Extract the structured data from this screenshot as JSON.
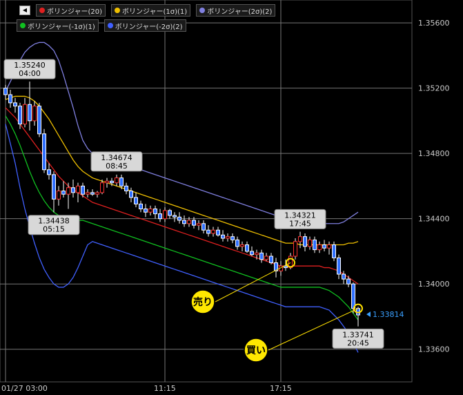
{
  "legend": [
    {
      "label": "ボリンジャー(20)",
      "color": "#e02020"
    },
    {
      "label": "ボリンジャー(1σ)(1)",
      "color": "#f0c000"
    },
    {
      "label": "ボリンジャー(2σ)(2)",
      "color": "#8080e0"
    },
    {
      "label": "ボリンジャー(-1σ)(1)",
      "color": "#10c020"
    },
    {
      "label": "ボリンジャー(-2σ)(2)",
      "color": "#4060ff"
    }
  ],
  "nav": {
    "back_icon": "◀"
  },
  "chart_data": {
    "type": "candlestick",
    "y_ticks": [
      "1.35600",
      "1.35200",
      "1.34800",
      "1.34400",
      "1.34000",
      "1.33600"
    ],
    "ylim": [
      1.334,
      1.3574
    ],
    "x_ticks": [
      {
        "label": "01/27 03:00",
        "i": 0
      },
      {
        "label": "11:15",
        "i": 33
      },
      {
        "label": "17:15",
        "i": 57
      }
    ],
    "price_marker": {
      "value": 1.33814,
      "label": "1.33814"
    },
    "callouts": [
      {
        "price": "1.35240",
        "time": "04:00",
        "i": 5,
        "value": 1.3524
      },
      {
        "price": "1.34438",
        "time": "05:15",
        "i": 10,
        "value": 1.34438
      },
      {
        "price": "1.34674",
        "time": "08:45",
        "i": 23,
        "value": 1.34674
      },
      {
        "price": "1.34321",
        "time": "17:45",
        "i": 61,
        "value": 1.34321
      },
      {
        "price": "1.33741",
        "time": "20:45",
        "i": 73,
        "value": 1.33741
      }
    ],
    "annotations": [
      {
        "label": "売り",
        "i": 59,
        "value": 1.3413
      },
      {
        "label": "買い",
        "i": 73,
        "value": 1.3385
      }
    ],
    "candles": [
      [
        1.352,
        1.3522,
        1.3513,
        1.3516
      ],
      [
        1.3516,
        1.3519,
        1.3508,
        1.3511
      ],
      [
        1.3511,
        1.3514,
        1.3505,
        1.3509
      ],
      [
        1.3509,
        1.3511,
        1.3495,
        1.3498
      ],
      [
        1.3498,
        1.3514,
        1.3496,
        1.351
      ],
      [
        1.351,
        1.3524,
        1.3494,
        1.35
      ],
      [
        1.35,
        1.3512,
        1.3497,
        1.3509
      ],
      [
        1.3509,
        1.3511,
        1.349,
        1.3492
      ],
      [
        1.3492,
        1.3495,
        1.3468,
        1.347
      ],
      [
        1.347,
        1.3474,
        1.3464,
        1.3467
      ],
      [
        1.3467,
        1.3469,
        1.3444,
        1.3452
      ],
      [
        1.3452,
        1.346,
        1.3448,
        1.3457
      ],
      [
        1.3457,
        1.3463,
        1.3453,
        1.3455
      ],
      [
        1.3455,
        1.3462,
        1.3446,
        1.3459
      ],
      [
        1.3459,
        1.3464,
        1.3453,
        1.3456
      ],
      [
        1.3456,
        1.3462,
        1.345,
        1.346
      ],
      [
        1.346,
        1.3462,
        1.3453,
        1.3455
      ],
      [
        1.3455,
        1.3458,
        1.3453,
        1.3456
      ],
      [
        1.3456,
        1.3458,
        1.3454,
        1.3455
      ],
      [
        1.3455,
        1.3457,
        1.3453,
        1.3456
      ],
      [
        1.3456,
        1.3464,
        1.3455,
        1.3462
      ],
      [
        1.3462,
        1.3465,
        1.3459,
        1.3463
      ],
      [
        1.3463,
        1.3465,
        1.346,
        1.3462
      ],
      [
        1.3462,
        1.3467,
        1.346,
        1.3465
      ],
      [
        1.3465,
        1.3467,
        1.3458,
        1.346
      ],
      [
        1.346,
        1.3462,
        1.3455,
        1.3457
      ],
      [
        1.3457,
        1.3459,
        1.345,
        1.3453
      ],
      [
        1.3453,
        1.3456,
        1.3447,
        1.3449
      ],
      [
        1.3449,
        1.3451,
        1.3444,
        1.3446
      ],
      [
        1.3446,
        1.3449,
        1.3441,
        1.3444
      ],
      [
        1.3444,
        1.3448,
        1.3442,
        1.3446
      ],
      [
        1.3446,
        1.3448,
        1.344,
        1.3443
      ],
      [
        1.3443,
        1.3446,
        1.3438,
        1.344
      ],
      [
        1.344,
        1.3447,
        1.3438,
        1.3445
      ],
      [
        1.3445,
        1.3446,
        1.344,
        1.3442
      ],
      [
        1.3442,
        1.3444,
        1.3438,
        1.3441
      ],
      [
        1.3441,
        1.3444,
        1.3437,
        1.3439
      ],
      [
        1.3439,
        1.3442,
        1.3435,
        1.3437
      ],
      [
        1.3437,
        1.3441,
        1.3435,
        1.3439
      ],
      [
        1.3439,
        1.3441,
        1.3434,
        1.3436
      ],
      [
        1.3436,
        1.3439,
        1.3433,
        1.3437
      ],
      [
        1.3437,
        1.3439,
        1.3431,
        1.3433
      ],
      [
        1.3433,
        1.3436,
        1.3429,
        1.3431
      ],
      [
        1.3431,
        1.3435,
        1.3429,
        1.3433
      ],
      [
        1.3433,
        1.3435,
        1.3429,
        1.343
      ],
      [
        1.343,
        1.3433,
        1.3426,
        1.3428
      ],
      [
        1.3428,
        1.3431,
        1.3426,
        1.3429
      ],
      [
        1.3429,
        1.3431,
        1.3425,
        1.3427
      ],
      [
        1.3427,
        1.3429,
        1.3421,
        1.3423
      ],
      [
        1.3423,
        1.3426,
        1.342,
        1.3424
      ],
      [
        1.3424,
        1.3426,
        1.3419,
        1.342
      ],
      [
        1.342,
        1.3423,
        1.3417,
        1.3418
      ],
      [
        1.3418,
        1.3421,
        1.3415,
        1.3419
      ],
      [
        1.3419,
        1.3421,
        1.3413,
        1.3415
      ],
      [
        1.3415,
        1.3419,
        1.3414,
        1.3417
      ],
      [
        1.3417,
        1.3419,
        1.3412,
        1.3413
      ],
      [
        1.3413,
        1.3416,
        1.3404,
        1.3408
      ],
      [
        1.3408,
        1.3414,
        1.3405,
        1.3411
      ],
      [
        1.3411,
        1.3415,
        1.3408,
        1.341
      ],
      [
        1.341,
        1.3419,
        1.3409,
        1.3417
      ],
      [
        1.3417,
        1.3428,
        1.3415,
        1.3426
      ],
      [
        1.3426,
        1.3432,
        1.3422,
        1.3429
      ],
      [
        1.3429,
        1.3431,
        1.342,
        1.3423
      ],
      [
        1.3423,
        1.3429,
        1.3421,
        1.3427
      ],
      [
        1.3427,
        1.3429,
        1.3419,
        1.3421
      ],
      [
        1.3421,
        1.3426,
        1.3419,
        1.3424
      ],
      [
        1.3424,
        1.3427,
        1.342,
        1.3422
      ],
      [
        1.3422,
        1.3426,
        1.3418,
        1.3424
      ],
      [
        1.3424,
        1.3426,
        1.3414,
        1.3416
      ],
      [
        1.3416,
        1.3418,
        1.3403,
        1.3406
      ],
      [
        1.3406,
        1.3408,
        1.34,
        1.3403
      ],
      [
        1.3403,
        1.3405,
        1.3398,
        1.34
      ],
      [
        1.34,
        1.3401,
        1.3382,
        1.3385
      ],
      [
        1.3385,
        1.3386,
        1.3374,
        1.3381
      ]
    ],
    "bands": {
      "mid": [
        1.3508,
        1.3505,
        1.3502,
        1.3498,
        1.3494,
        1.349,
        1.3486,
        1.3482,
        1.3478,
        1.3474,
        1.347,
        1.3466,
        1.3463,
        1.346,
        1.3458,
        1.3456,
        1.3454,
        1.3452,
        1.345,
        1.3449,
        1.3448,
        1.3447,
        1.3446,
        1.3445,
        1.3444,
        1.3443,
        1.3442,
        1.3441,
        1.344,
        1.3439,
        1.3438,
        1.3437,
        1.3436,
        1.3435,
        1.3434,
        1.3433,
        1.3432,
        1.3431,
        1.343,
        1.3429,
        1.3428,
        1.3427,
        1.3426,
        1.3425,
        1.3424,
        1.3423,
        1.3422,
        1.3421,
        1.342,
        1.3419,
        1.3418,
        1.3417,
        1.3416,
        1.3415,
        1.3414,
        1.3413,
        1.3412,
        1.3411,
        1.3411,
        1.3411,
        1.3411,
        1.3411,
        1.3411,
        1.3411,
        1.3411,
        1.3411,
        1.341,
        1.341,
        1.3409,
        1.3408,
        1.3406,
        1.3404,
        1.3402,
        1.34
      ],
      "up1": [
        1.3513,
        1.3514,
        1.3515,
        1.3515,
        1.3515,
        1.3514,
        1.3512,
        1.3509,
        1.3505,
        1.3501,
        1.3496,
        1.3491,
        1.3486,
        1.3481,
        1.3476,
        1.3472,
        1.3469,
        1.3467,
        1.3465,
        1.3464,
        1.3463,
        1.3462,
        1.3461,
        1.346,
        1.3459,
        1.3458,
        1.3457,
        1.3456,
        1.3455,
        1.3454,
        1.3453,
        1.3452,
        1.3451,
        1.345,
        1.3449,
        1.3448,
        1.3447,
        1.3446,
        1.3445,
        1.3444,
        1.3443,
        1.3442,
        1.3441,
        1.344,
        1.3439,
        1.3438,
        1.3437,
        1.3436,
        1.3435,
        1.3434,
        1.3433,
        1.3432,
        1.3431,
        1.343,
        1.3429,
        1.3428,
        1.3427,
        1.3426,
        1.3425,
        1.3425,
        1.3425,
        1.3424,
        1.3424,
        1.3424,
        1.3424,
        1.3424,
        1.3424,
        1.3424,
        1.3424,
        1.3424,
        1.3424,
        1.3425,
        1.3425,
        1.3426
      ],
      "up2": [
        1.3518,
        1.3524,
        1.353,
        1.3537,
        1.3542,
        1.3545,
        1.3547,
        1.3548,
        1.3548,
        1.3546,
        1.3543,
        1.3537,
        1.3528,
        1.3518,
        1.3508,
        1.3497,
        1.3488,
        1.3483,
        1.348,
        1.3479,
        1.3478,
        1.3477,
        1.3476,
        1.3475,
        1.3474,
        1.3473,
        1.3472,
        1.3471,
        1.347,
        1.3469,
        1.3468,
        1.3467,
        1.3466,
        1.3465,
        1.3464,
        1.3463,
        1.3462,
        1.3461,
        1.346,
        1.3459,
        1.3458,
        1.3457,
        1.3456,
        1.3455,
        1.3454,
        1.3453,
        1.3452,
        1.3451,
        1.345,
        1.3449,
        1.3448,
        1.3447,
        1.3446,
        1.3445,
        1.3444,
        1.3443,
        1.3442,
        1.3441,
        1.344,
        1.344,
        1.344,
        1.3439,
        1.3439,
        1.3438,
        1.3438,
        1.3437,
        1.3437,
        1.3437,
        1.3437,
        1.3437,
        1.3438,
        1.344,
        1.3442,
        1.3444
      ],
      "dn1": [
        1.3503,
        1.3498,
        1.3492,
        1.3485,
        1.3477,
        1.3469,
        1.3462,
        1.3456,
        1.3451,
        1.3447,
        1.3444,
        1.3442,
        1.344,
        1.3439,
        1.3439,
        1.3439,
        1.3439,
        1.3438,
        1.3437,
        1.3436,
        1.3435,
        1.3434,
        1.3433,
        1.3432,
        1.3431,
        1.343,
        1.3429,
        1.3428,
        1.3427,
        1.3426,
        1.3425,
        1.3424,
        1.3423,
        1.3422,
        1.3421,
        1.342,
        1.3419,
        1.3418,
        1.3417,
        1.3416,
        1.3415,
        1.3414,
        1.3413,
        1.3412,
        1.3411,
        1.341,
        1.3409,
        1.3408,
        1.3407,
        1.3406,
        1.3405,
        1.3404,
        1.3403,
        1.3402,
        1.3401,
        1.34,
        1.3399,
        1.3398,
        1.3398,
        1.3398,
        1.3398,
        1.3398,
        1.3398,
        1.3398,
        1.3398,
        1.3398,
        1.3397,
        1.3396,
        1.3394,
        1.3392,
        1.3389,
        1.3386,
        1.3382,
        1.3378
      ],
      "dn2": [
        1.3498,
        1.3486,
        1.3474,
        1.3459,
        1.3446,
        1.3435,
        1.3425,
        1.3416,
        1.3409,
        1.3404,
        1.34,
        1.3398,
        1.3398,
        1.34,
        1.3404,
        1.341,
        1.3417,
        1.3424,
        1.3426,
        1.3425,
        1.3424,
        1.3423,
        1.3422,
        1.3421,
        1.342,
        1.3419,
        1.3418,
        1.3417,
        1.3416,
        1.3415,
        1.3414,
        1.3413,
        1.3412,
        1.3411,
        1.341,
        1.3409,
        1.3408,
        1.3407,
        1.3406,
        1.3405,
        1.3404,
        1.3403,
        1.3402,
        1.3401,
        1.34,
        1.3399,
        1.3398,
        1.3397,
        1.3396,
        1.3395,
        1.3394,
        1.3393,
        1.3392,
        1.3391,
        1.339,
        1.3389,
        1.3388,
        1.3387,
        1.3386,
        1.3386,
        1.3386,
        1.3386,
        1.3386,
        1.3386,
        1.3386,
        1.3386,
        1.3385,
        1.3384,
        1.3381,
        1.3378,
        1.3374,
        1.337,
        1.3364,
        1.3358
      ]
    }
  }
}
